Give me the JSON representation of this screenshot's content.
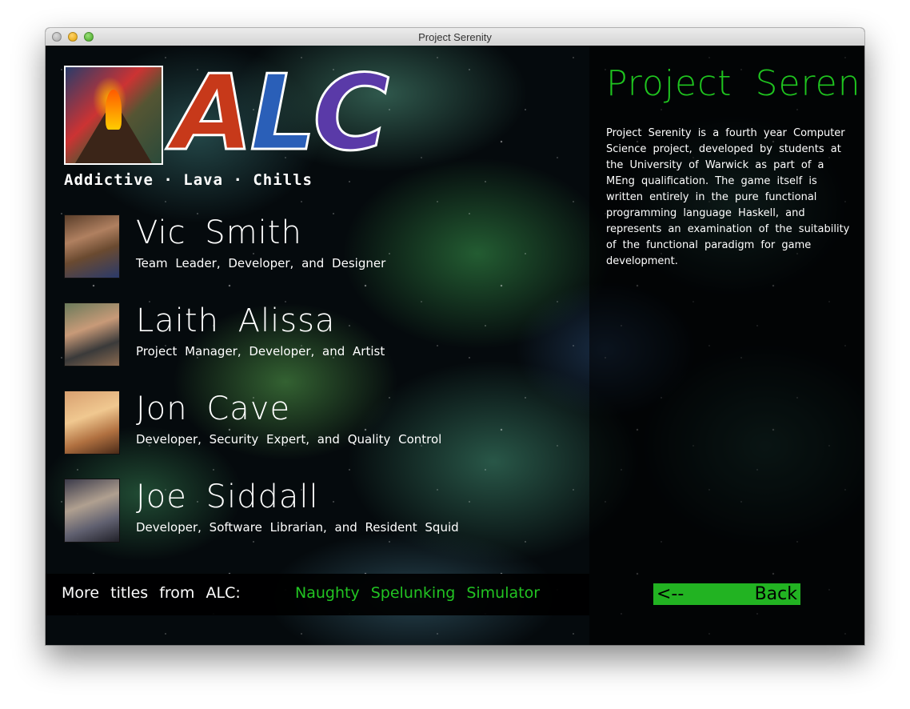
{
  "window": {
    "title": "Project Serenity"
  },
  "logo": {
    "letters": [
      "A",
      "L",
      "C"
    ],
    "tagline": "Addictive · Lava · Chills"
  },
  "team": [
    {
      "name": "Vic Smith",
      "role": "Team Leader, Developer, and Designer"
    },
    {
      "name": "Laith Alissa",
      "role": "Project Manager, Developer, and Artist"
    },
    {
      "name": "Jon Cave",
      "role": "Developer, Security Expert, and Quality Control"
    },
    {
      "name": "Joe Siddall",
      "role": "Developer, Software Librarian, and Resident Squid"
    }
  ],
  "footer": {
    "label": "More titles from ALC:",
    "link": "Naughty Spelunking Simulator"
  },
  "panel": {
    "title": "Project Serenity",
    "description": "Project Serenity is a fourth year Computer Science project, developed by students at the University of Warwick as part of a MEng qualification. The game itself is written entirely in the pure functional programming language Haskell, and represents an examination of the suitability of the functional paradigm for game development.",
    "back_arrow": "<--",
    "back_label": "Back"
  },
  "colors": {
    "accent_green": "#1fc41f",
    "button_green": "#22b322"
  }
}
